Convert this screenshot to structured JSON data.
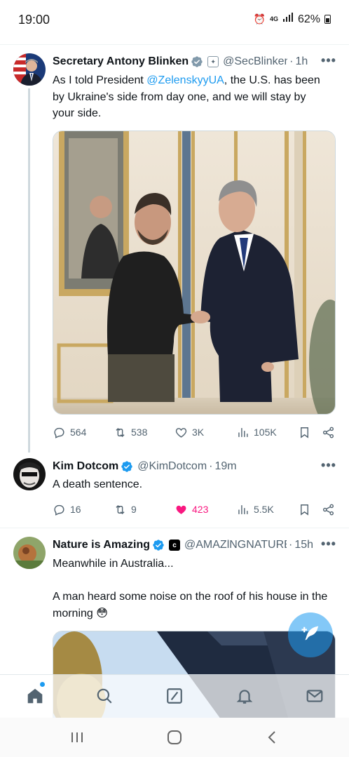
{
  "status_bar": {
    "time": "19:00",
    "network": "4G",
    "battery": "62%"
  },
  "tweets": [
    {
      "name": "Secretary Antony Blinken",
      "handle": "@SecBlinken",
      "time": "1h",
      "text_before": "As I told President ",
      "mention": "@ZelenskyyUA",
      "text_after": ", the U.S. has been by Ukraine's side from day one, and we will stay by your side.",
      "stats": {
        "replies": "564",
        "reposts": "538",
        "likes": "3K",
        "views": "105K"
      },
      "icons": [
        "verified-badge-icon",
        "government-seal-icon",
        "photo-handshake"
      ]
    },
    {
      "name": "Kim Dotcom",
      "handle": "@KimDotcom",
      "time": "19m",
      "text": "A death sentence.",
      "stats": {
        "replies": "16",
        "reposts": "9",
        "likes": "423",
        "views": "5.5K"
      },
      "liked": true
    },
    {
      "name": "Nature is Amazing",
      "handle": "@AMAZlNGNATURE",
      "time": "15h",
      "text_line1": "Meanwhile in Australia...",
      "text_line2": "A man heard some noise on the roof of his house in the morning 😳"
    }
  ],
  "colors": {
    "accent": "#1d9bf0",
    "like": "#f91880",
    "secondary_text": "#536471"
  },
  "tabs": [
    "home-icon",
    "search-icon",
    "grok-icon",
    "notifications-icon",
    "messages-icon"
  ],
  "system_nav": [
    "recents-icon",
    "home-circle-icon",
    "back-icon"
  ]
}
